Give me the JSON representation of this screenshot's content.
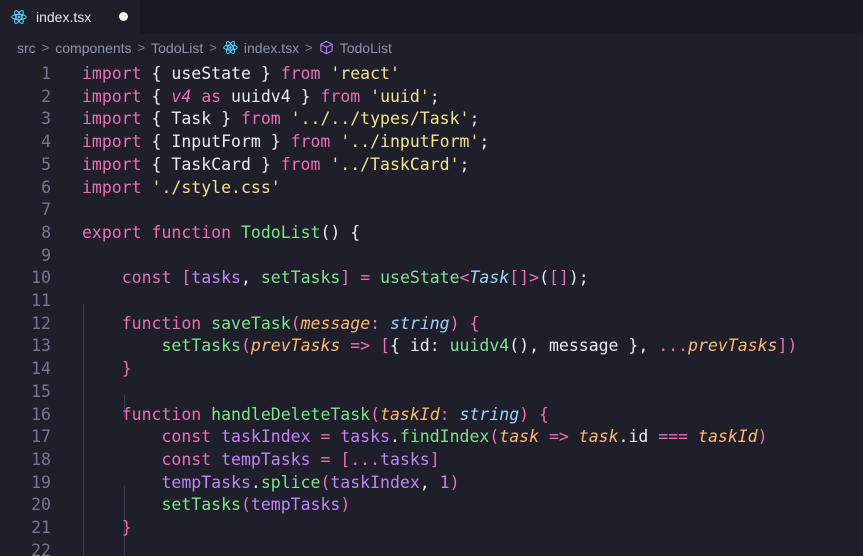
{
  "tab": {
    "filename": "index.tsx",
    "icon": "react-icon",
    "unsaved": true
  },
  "breadcrumb": [
    {
      "label": "src"
    },
    {
      "label": "components"
    },
    {
      "label": "TodoList"
    },
    {
      "label": "index.tsx",
      "icon": "react-icon"
    },
    {
      "label": "TodoList",
      "icon": "cube-icon"
    }
  ],
  "colors": {
    "background": "#1e1f2b",
    "keyword": "#ec6fb3",
    "variable": "#bf86f4",
    "string": "#f0e68c",
    "function": "#7fe38a",
    "type": "#9dd6fa",
    "parameter": "#ffb874",
    "plain": "#e9edf2",
    "line_number": "#747891"
  },
  "lines": [
    {
      "n": "1",
      "tokens": [
        [
          "k",
          "import"
        ],
        [
          "p",
          " { useState } "
        ],
        [
          "k",
          "from"
        ],
        [
          "p",
          " "
        ],
        [
          "s",
          "'react'"
        ]
      ]
    },
    {
      "n": "2",
      "tokens": [
        [
          "k",
          "import"
        ],
        [
          "p",
          " { "
        ],
        [
          "a",
          "v4"
        ],
        [
          "p",
          " "
        ],
        [
          "k",
          "as"
        ],
        [
          "p",
          " uuidv4 } "
        ],
        [
          "k",
          "from"
        ],
        [
          "p",
          " "
        ],
        [
          "s",
          "'uuid'"
        ],
        [
          "p",
          ";"
        ]
      ]
    },
    {
      "n": "3",
      "tokens": [
        [
          "k",
          "import"
        ],
        [
          "p",
          " { Task } "
        ],
        [
          "k",
          "from"
        ],
        [
          "p",
          " "
        ],
        [
          "s",
          "'../../types/Task'"
        ],
        [
          "p",
          ";"
        ]
      ]
    },
    {
      "n": "4",
      "tokens": [
        [
          "k",
          "import"
        ],
        [
          "p",
          " { InputForm } "
        ],
        [
          "k",
          "from"
        ],
        [
          "p",
          " "
        ],
        [
          "s",
          "'../inputForm'"
        ],
        [
          "p",
          ";"
        ]
      ]
    },
    {
      "n": "5",
      "tokens": [
        [
          "k",
          "import"
        ],
        [
          "p",
          " { TaskCard } "
        ],
        [
          "k",
          "from"
        ],
        [
          "p",
          " "
        ],
        [
          "s",
          "'../TaskCard'"
        ],
        [
          "p",
          ";"
        ]
      ]
    },
    {
      "n": "6",
      "tokens": [
        [
          "k",
          "import"
        ],
        [
          "p",
          " "
        ],
        [
          "s",
          "'./style.css'"
        ]
      ]
    },
    {
      "n": "7",
      "tokens": []
    },
    {
      "n": "8",
      "tokens": [
        [
          "k",
          "export"
        ],
        [
          "p",
          " "
        ],
        [
          "k",
          "function"
        ],
        [
          "p",
          " "
        ],
        [
          "f",
          "TodoList"
        ],
        [
          "p",
          "() {"
        ]
      ]
    },
    {
      "n": "9",
      "tokens": []
    },
    {
      "n": "10",
      "tokens": [
        [
          "p",
          "    "
        ],
        [
          "k",
          "const"
        ],
        [
          "p",
          " "
        ],
        [
          "k",
          "["
        ],
        [
          "v",
          "tasks"
        ],
        [
          "p",
          ", "
        ],
        [
          "f",
          "setTasks"
        ],
        [
          "k",
          "]"
        ],
        [
          "p",
          " "
        ],
        [
          "k",
          "="
        ],
        [
          "p",
          " "
        ],
        [
          "f",
          "useState"
        ],
        [
          "k",
          "<"
        ],
        [
          "t",
          "Task"
        ],
        [
          "k",
          "[]>"
        ],
        [
          "p",
          "("
        ],
        [
          "k",
          "[]"
        ],
        [
          "p",
          ");"
        ]
      ]
    },
    {
      "n": "11",
      "tokens": []
    },
    {
      "n": "12",
      "tokens": [
        [
          "p",
          "    "
        ],
        [
          "k",
          "function"
        ],
        [
          "p",
          " "
        ],
        [
          "f",
          "saveTask"
        ],
        [
          "k",
          "("
        ],
        [
          "pa",
          "message"
        ],
        [
          "k",
          ":"
        ],
        [
          "p",
          " "
        ],
        [
          "t",
          "string"
        ],
        [
          "k",
          ")"
        ],
        [
          "p",
          " "
        ],
        [
          "k",
          "{"
        ]
      ]
    },
    {
      "n": "13",
      "tokens": [
        [
          "p",
          "        "
        ],
        [
          "f",
          "setTasks"
        ],
        [
          "k",
          "("
        ],
        [
          "pa",
          "prevTasks"
        ],
        [
          "p",
          " "
        ],
        [
          "k",
          "=>"
        ],
        [
          "p",
          " "
        ],
        [
          "k",
          "["
        ],
        [
          "p",
          "{ id: "
        ],
        [
          "f",
          "uuidv4"
        ],
        [
          "p",
          "(), message }, "
        ],
        [
          "k",
          "..."
        ],
        [
          "pa",
          "prevTasks"
        ],
        [
          "k",
          "])"
        ]
      ]
    },
    {
      "n": "14",
      "tokens": [
        [
          "p",
          "    "
        ],
        [
          "k",
          "}"
        ]
      ]
    },
    {
      "n": "15",
      "tokens": []
    },
    {
      "n": "16",
      "tokens": [
        [
          "p",
          "    "
        ],
        [
          "k",
          "function"
        ],
        [
          "p",
          " "
        ],
        [
          "f",
          "handleDeleteTask"
        ],
        [
          "k",
          "("
        ],
        [
          "pa",
          "taskId"
        ],
        [
          "k",
          ":"
        ],
        [
          "p",
          " "
        ],
        [
          "t",
          "string"
        ],
        [
          "k",
          ")"
        ],
        [
          "p",
          " "
        ],
        [
          "k",
          "{"
        ]
      ]
    },
    {
      "n": "17",
      "tokens": [
        [
          "p",
          "        "
        ],
        [
          "k",
          "const"
        ],
        [
          "p",
          " "
        ],
        [
          "v",
          "taskIndex"
        ],
        [
          "p",
          " "
        ],
        [
          "k",
          "="
        ],
        [
          "p",
          " "
        ],
        [
          "v",
          "tasks"
        ],
        [
          "p",
          "."
        ],
        [
          "f",
          "findIndex"
        ],
        [
          "k",
          "("
        ],
        [
          "pa",
          "task"
        ],
        [
          "p",
          " "
        ],
        [
          "k",
          "=>"
        ],
        [
          "p",
          " "
        ],
        [
          "pa",
          "task"
        ],
        [
          "p",
          ".id "
        ],
        [
          "k",
          "==="
        ],
        [
          "p",
          " "
        ],
        [
          "pa",
          "taskId"
        ],
        [
          "k",
          ")"
        ]
      ]
    },
    {
      "n": "18",
      "tokens": [
        [
          "p",
          "        "
        ],
        [
          "k",
          "const"
        ],
        [
          "p",
          " "
        ],
        [
          "v",
          "tempTasks"
        ],
        [
          "p",
          " "
        ],
        [
          "k",
          "="
        ],
        [
          "p",
          " "
        ],
        [
          "k",
          "[..."
        ],
        [
          "v",
          "tasks"
        ],
        [
          "k",
          "]"
        ]
      ]
    },
    {
      "n": "19",
      "tokens": [
        [
          "p",
          "        "
        ],
        [
          "v",
          "tempTasks"
        ],
        [
          "p",
          "."
        ],
        [
          "f",
          "splice"
        ],
        [
          "k",
          "("
        ],
        [
          "v",
          "taskIndex"
        ],
        [
          "p",
          ", "
        ],
        [
          "v",
          "1"
        ],
        [
          "k",
          ")"
        ]
      ]
    },
    {
      "n": "20",
      "tokens": [
        [
          "p",
          "        "
        ],
        [
          "f",
          "setTasks"
        ],
        [
          "k",
          "("
        ],
        [
          "v",
          "tempTasks"
        ],
        [
          "k",
          ")"
        ]
      ]
    },
    {
      "n": "21",
      "tokens": [
        [
          "p",
          "    "
        ],
        [
          "k",
          "}"
        ]
      ]
    },
    {
      "n": "22",
      "tokens": []
    }
  ]
}
